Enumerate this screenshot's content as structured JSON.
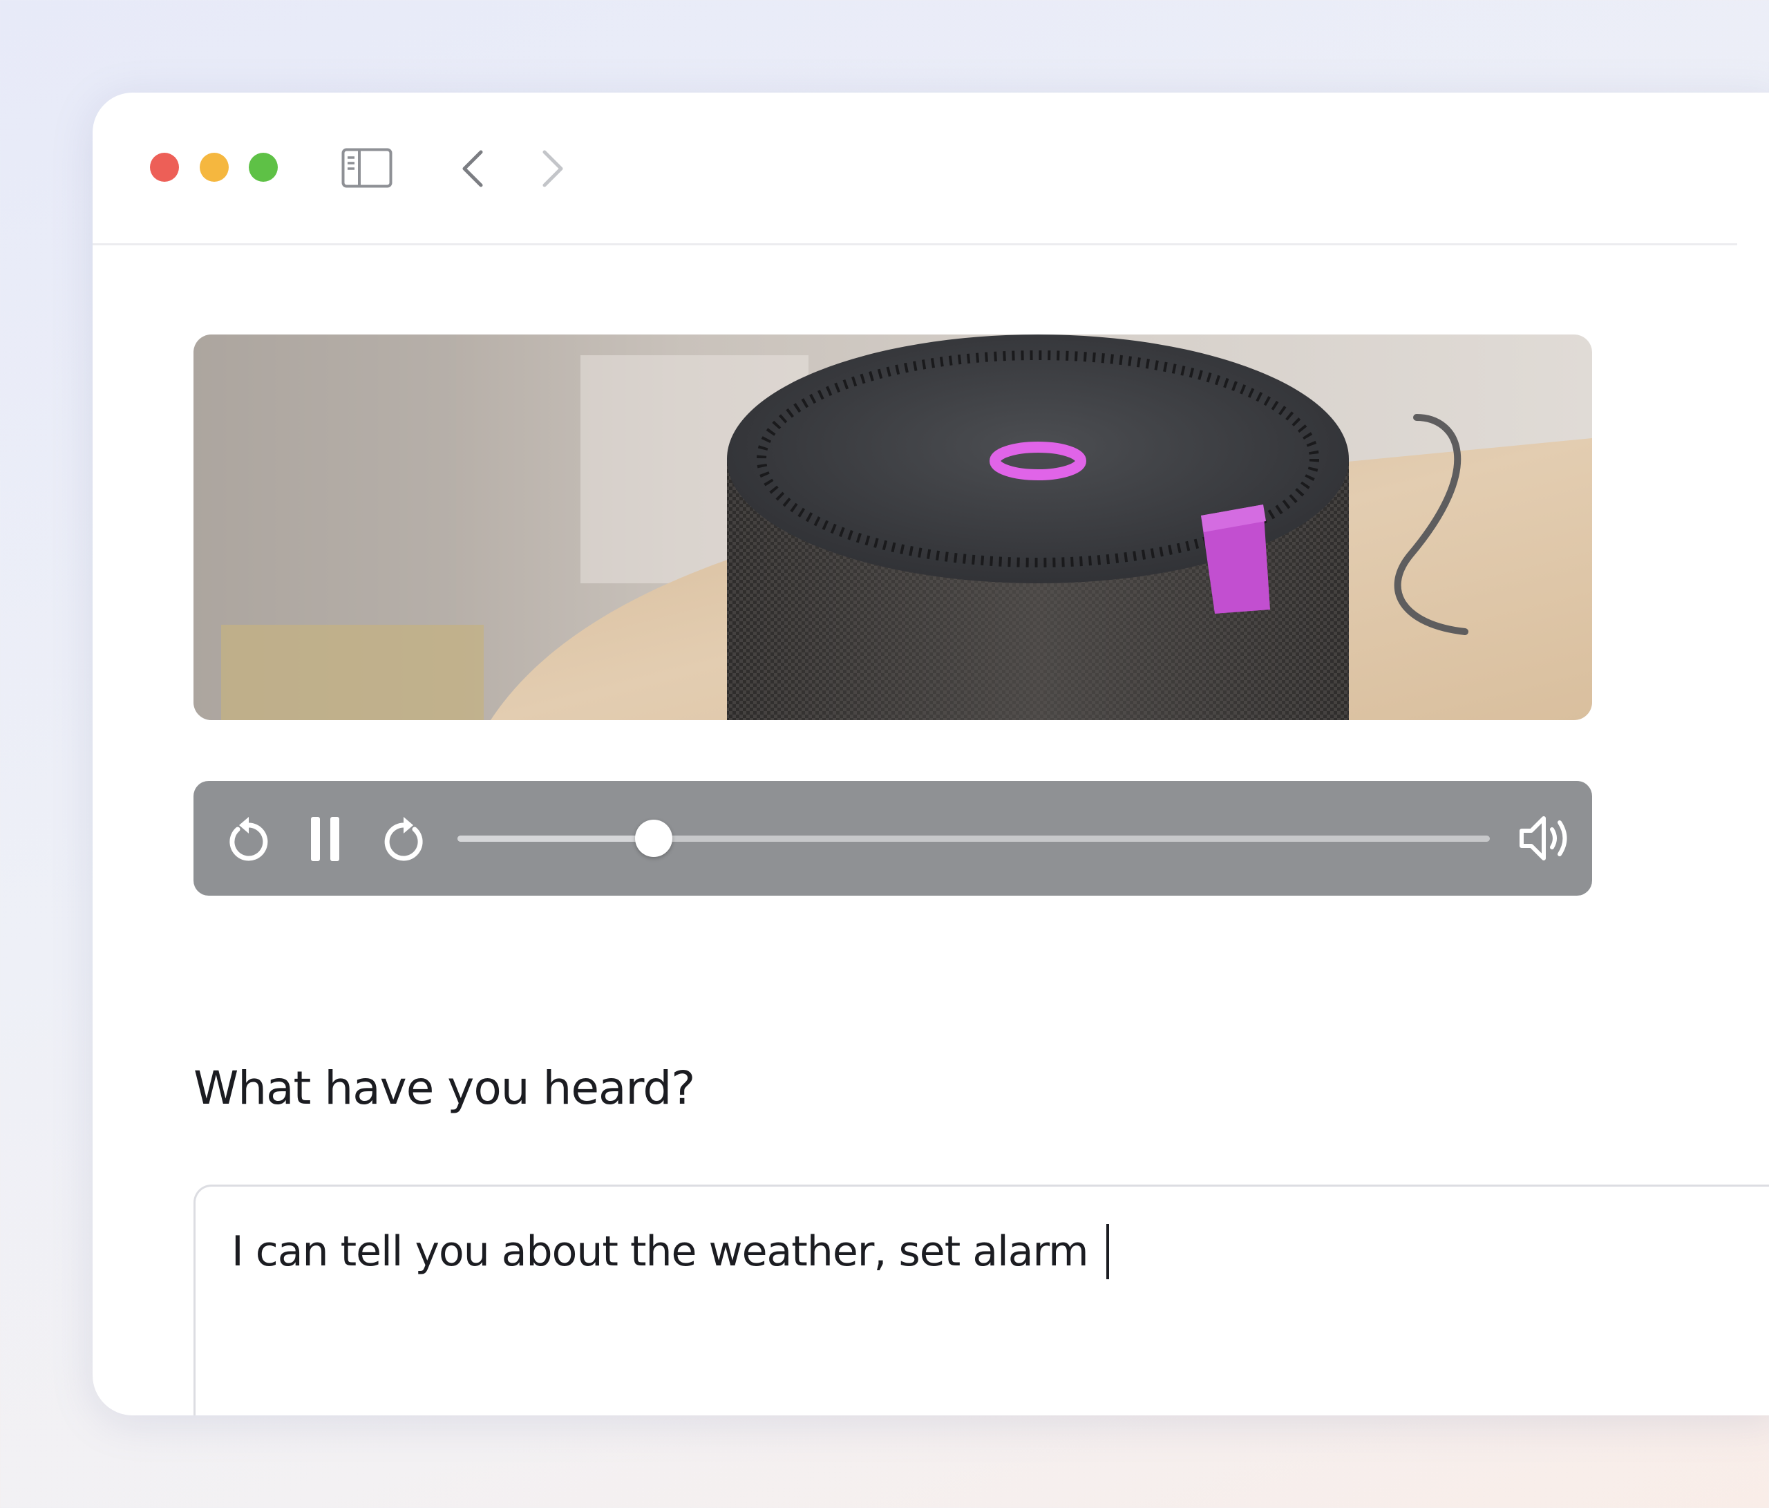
{
  "colors": {
    "traffic_close": "#ed5f57",
    "traffic_minimize": "#f5b73f",
    "traffic_maximize": "#5ec146",
    "player_background": "#8f9194",
    "speaker_light": "#e064e8"
  },
  "toolbar": {
    "icons": [
      "close-icon",
      "minimize-icon",
      "maximize-icon",
      "sidebar-toggle-icon",
      "chevron-left-icon",
      "chevron-right-icon"
    ]
  },
  "player": {
    "state": "paused-button-shown",
    "progress_fraction": 0.19,
    "icons": [
      "rewind-icon",
      "pause-icon",
      "forward-icon",
      "volume-icon"
    ]
  },
  "question": {
    "text": "What have you heard?"
  },
  "answer": {
    "value": "I can tell you about the weather, set alarm"
  }
}
